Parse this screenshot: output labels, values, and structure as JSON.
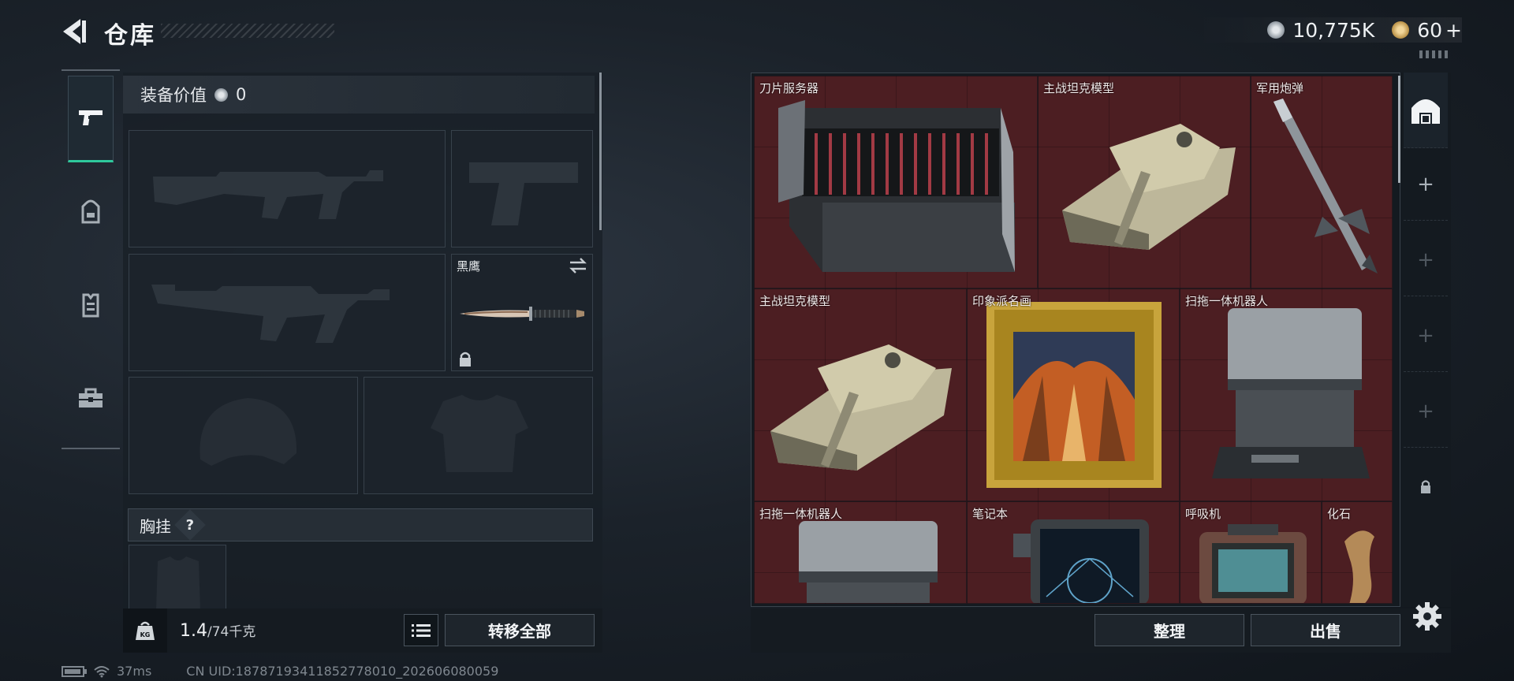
{
  "header": {
    "title": "仓库",
    "back_icon": "back-arrow-icon"
  },
  "currency": {
    "coins": {
      "value": "10,775K",
      "icon": "coin-icon",
      "color": "#c9d0d6"
    },
    "tickets": {
      "value": "60",
      "plus": "+",
      "icon": "ticket-icon",
      "color": "#d9b56a"
    }
  },
  "left_tabs": [
    {
      "name": "weapons",
      "icon": "pistol-icon",
      "active": true
    },
    {
      "name": "backpack",
      "icon": "backpack-icon",
      "active": false
    },
    {
      "name": "vest",
      "icon": "vest-icon",
      "active": false
    },
    {
      "name": "toolbox",
      "icon": "toolbox-icon",
      "active": false
    }
  ],
  "equipment": {
    "value_label": "装备价值",
    "value": "0",
    "melee_label": "黑鹰",
    "chest_label": "胸挂",
    "chest_help": "?"
  },
  "capacity": {
    "current": "1.4",
    "max": "/74千克",
    "icon": "weight-kg-icon"
  },
  "buttons": {
    "transfer_all": "转移全部",
    "sort": "整理",
    "sell": "出售"
  },
  "container_items": [
    {
      "label": "刀片服务器",
      "icon": "blade-server-icon"
    },
    {
      "label": "主战坦克模型",
      "icon": "tank-model-icon"
    },
    {
      "label": "军用炮弹",
      "icon": "missile-icon"
    },
    {
      "label": "主战坦克模型",
      "icon": "tank-model-icon"
    },
    {
      "label": "印象派名画",
      "icon": "painting-icon"
    },
    {
      "label": "扫拖一体机器人",
      "icon": "robot-vacuum-icon"
    },
    {
      "label": "扫拖一体机器人",
      "icon": "robot-vacuum-icon"
    },
    {
      "label": "笔记本",
      "icon": "laptop-icon"
    },
    {
      "label": "呼吸机",
      "icon": "ventilator-icon"
    },
    {
      "label": "化石",
      "icon": "fossil-icon"
    }
  ],
  "status": {
    "ping": "37ms",
    "uid": "CN UID:18787193411852778010_202606080059"
  },
  "colors": {
    "accent": "#2ec89c",
    "grid_bg": "#4c1e22",
    "panel_bg": "#1c232b"
  }
}
